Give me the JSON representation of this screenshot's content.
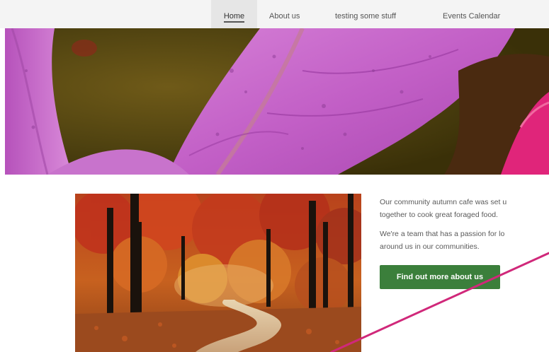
{
  "nav": {
    "items": [
      {
        "label": "Home",
        "active": true
      },
      {
        "label": "About us",
        "active": false
      },
      {
        "label": "testing some stuff",
        "active": false
      },
      {
        "label": "Events Calendar",
        "active": false
      }
    ]
  },
  "main": {
    "intro_line_1": "Our community autumn cafe was set u",
    "intro_line_2": "together to cook great foraged food.",
    "intro_line_3": "We're a team that has a passion for lo",
    "intro_line_4": "around us in our communities.",
    "cta_label": "Find out more about us"
  },
  "colors": {
    "cta_background": "#3b7f3b",
    "annotation_line": "#d0287a",
    "nav_background": "#f4f4f4"
  }
}
